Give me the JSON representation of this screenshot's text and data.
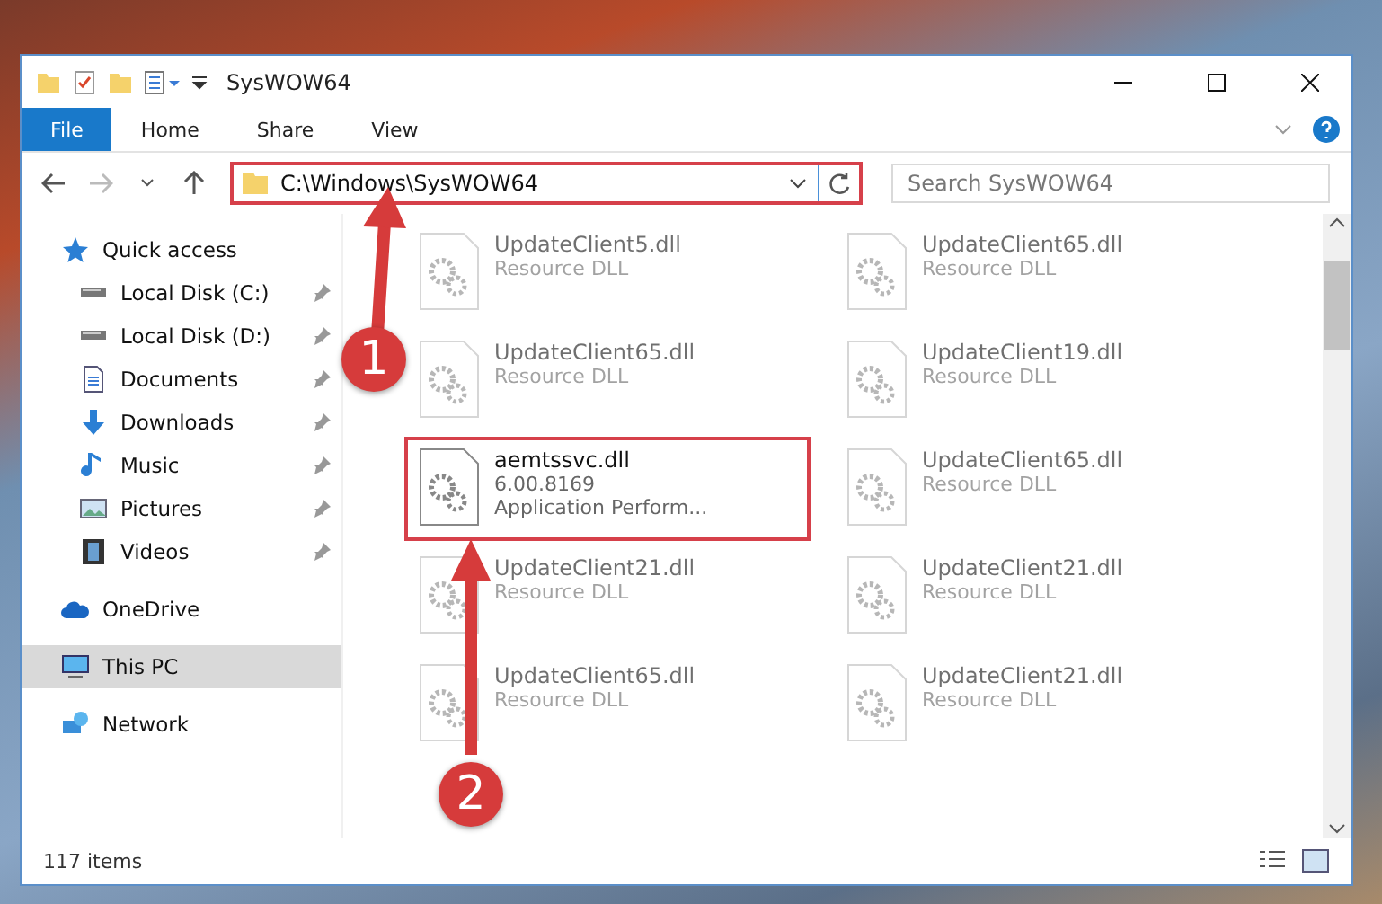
{
  "window": {
    "title": "SysWOW64"
  },
  "ribbon_tabs": [
    {
      "label": "File",
      "selected": true
    },
    {
      "label": "Home",
      "selected": false
    },
    {
      "label": "Share",
      "selected": false
    },
    {
      "label": "View",
      "selected": false
    }
  ],
  "address": {
    "path": "C:\\Windows\\SysWOW64",
    "highlighted": true
  },
  "search": {
    "placeholder": "Search SysWOW64"
  },
  "sidebar": {
    "items": [
      {
        "label": "Quick access",
        "kind": "star",
        "selected": false,
        "children": [
          {
            "label": "Local Disk (C:)",
            "kind": "drive",
            "pinned": true,
            "selected": false
          },
          {
            "label": "Local Disk (D:)",
            "kind": "drive",
            "pinned": true,
            "selected": false
          },
          {
            "label": "Documents",
            "kind": "document",
            "pinned": true,
            "selected": false
          },
          {
            "label": "Downloads",
            "kind": "download",
            "pinned": true,
            "selected": false
          },
          {
            "label": "Music",
            "kind": "music",
            "pinned": true,
            "selected": false
          },
          {
            "label": "Pictures",
            "kind": "picture",
            "pinned": true,
            "selected": false
          },
          {
            "label": "Videos",
            "kind": "video",
            "pinned": true,
            "selected": false
          }
        ]
      },
      {
        "label": "OneDrive",
        "kind": "cloud",
        "selected": false
      },
      {
        "label": "This PC",
        "kind": "pc",
        "selected": true
      },
      {
        "label": "Network",
        "kind": "network",
        "selected": false
      }
    ]
  },
  "files": [
    {
      "name": "UpdateClient5.dll",
      "details": [
        "Resource DLL"
      ],
      "faded": true,
      "highlighted": false
    },
    {
      "name": "UpdateClient65.dll",
      "details": [
        "Resource DLL"
      ],
      "faded": true,
      "highlighted": false
    },
    {
      "name": "UpdateClient65.dll",
      "details": [
        "Resource DLL"
      ],
      "faded": true,
      "highlighted": false
    },
    {
      "name": "UpdateClient19.dll",
      "details": [
        "Resource DLL"
      ],
      "faded": true,
      "highlighted": false
    },
    {
      "name": "aemtssvc.dll",
      "details": [
        "6.00.8169",
        "Application Perform..."
      ],
      "faded": false,
      "highlighted": true
    },
    {
      "name": "UpdateClient65.dll",
      "details": [
        "Resource DLL"
      ],
      "faded": true,
      "highlighted": false
    },
    {
      "name": "UpdateClient21.dll",
      "details": [
        "Resource DLL"
      ],
      "faded": true,
      "highlighted": false
    },
    {
      "name": "UpdateClient21.dll",
      "details": [
        "Resource DLL"
      ],
      "faded": true,
      "highlighted": false
    },
    {
      "name": "UpdateClient65.dll",
      "details": [
        "Resource DLL"
      ],
      "faded": true,
      "highlighted": false
    },
    {
      "name": "UpdateClient21.dll",
      "details": [
        "Resource DLL"
      ],
      "faded": true,
      "highlighted": false
    }
  ],
  "status_bar": {
    "items": "117 items"
  },
  "annotations": [
    {
      "label": "1"
    },
    {
      "label": "2"
    }
  ]
}
